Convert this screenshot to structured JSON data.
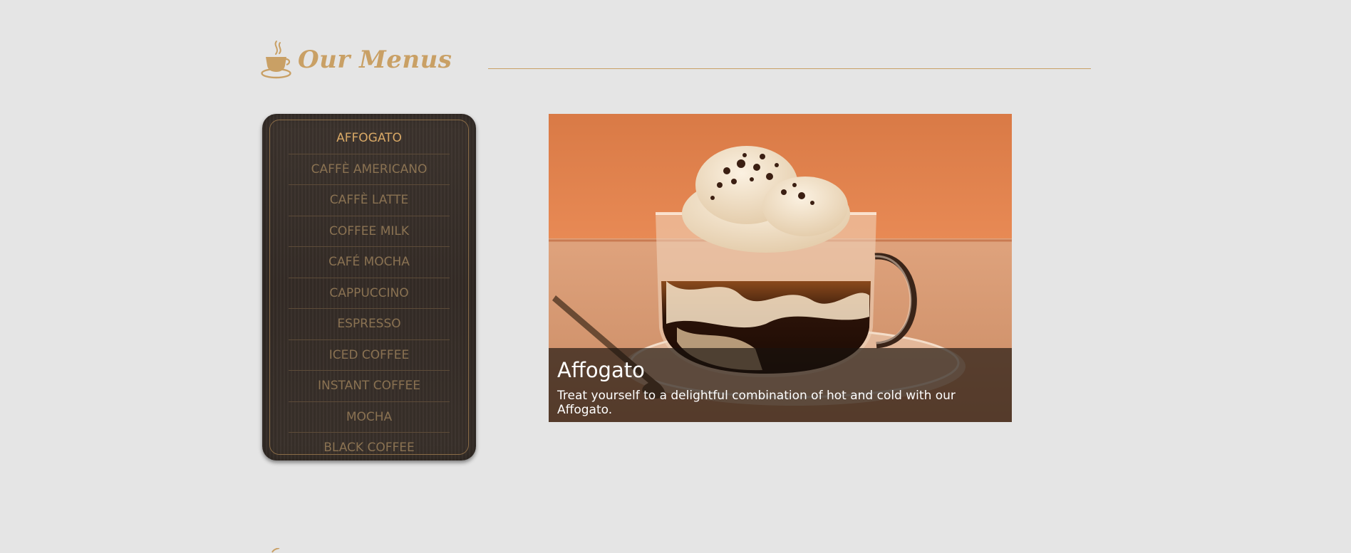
{
  "header": {
    "title": "Our Menus",
    "icon": "coffee-cup-icon",
    "accent_color": "#c9a065"
  },
  "menu": {
    "items": [
      {
        "label": "AFFOGATO",
        "active": true
      },
      {
        "label": "CAFFÈ AMERICANO",
        "active": false
      },
      {
        "label": "CAFFÈ LATTE",
        "active": false
      },
      {
        "label": "COFFEE MILK",
        "active": false
      },
      {
        "label": "CAFÉ MOCHA",
        "active": false
      },
      {
        "label": "CAPPUCCINO",
        "active": false
      },
      {
        "label": "ESPRESSO",
        "active": false
      },
      {
        "label": "ICED COFFEE",
        "active": false
      },
      {
        "label": "INSTANT COFFEE",
        "active": false
      },
      {
        "label": "MOCHA",
        "active": false
      },
      {
        "label": "BLACK COFFEE",
        "active": false
      }
    ],
    "active_color": "#d9a966",
    "inactive_color": "#8a7252"
  },
  "feature": {
    "title": "Affogato",
    "description": "Treat yourself to a delightful combination of hot and cold with our Affogato."
  }
}
